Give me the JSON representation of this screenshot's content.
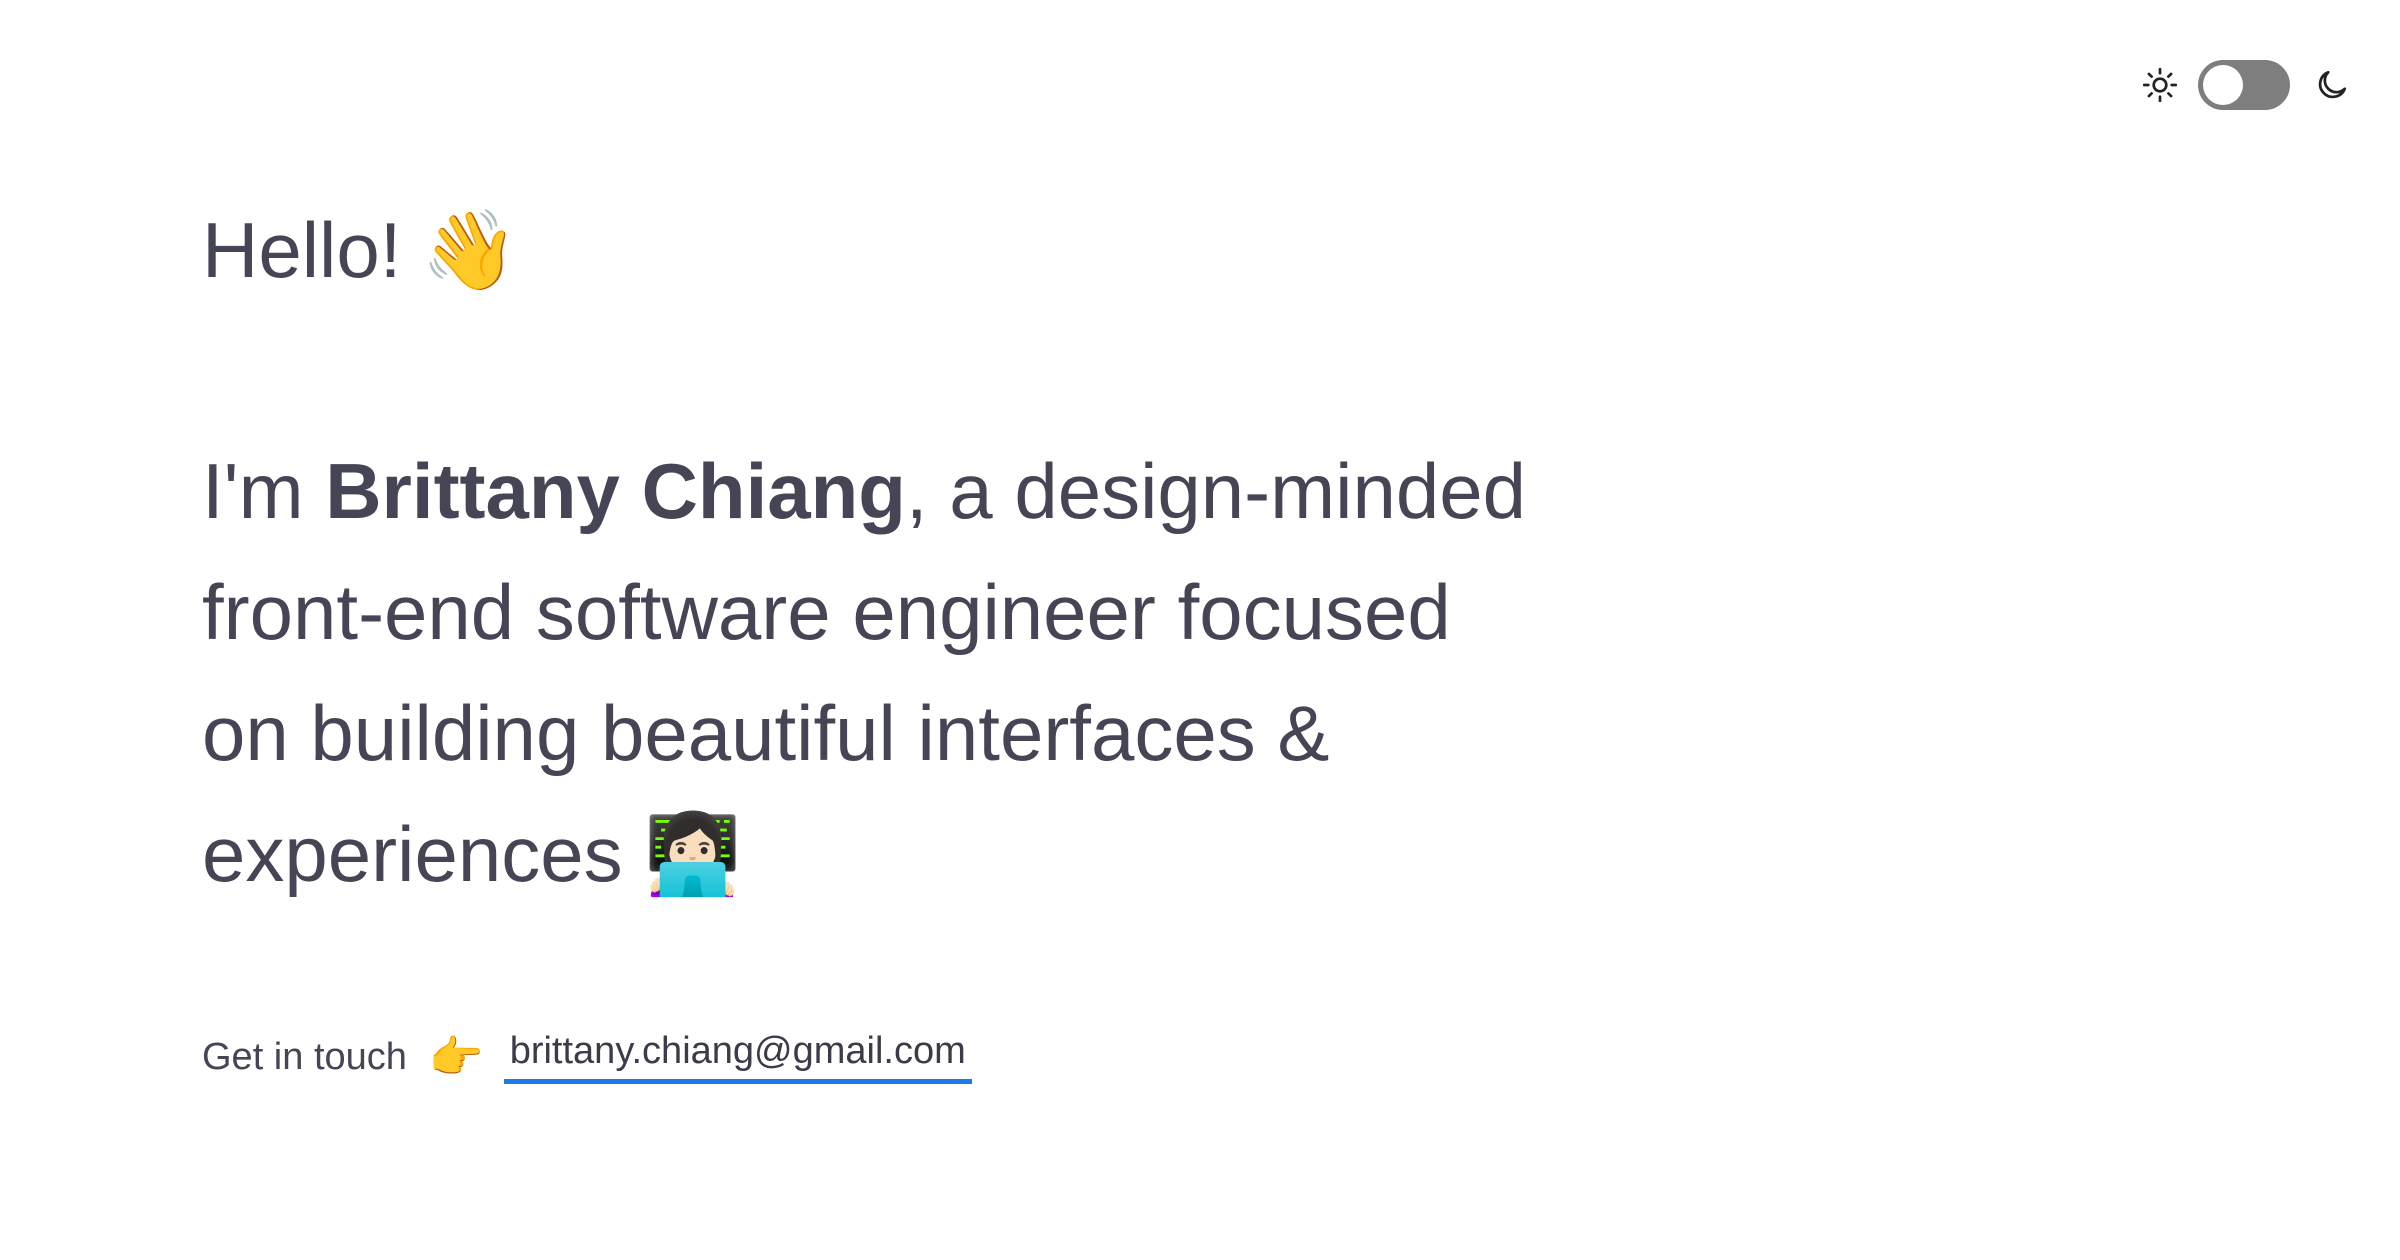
{
  "theme_toggle": {
    "sun_icon": "sun-icon",
    "moon_icon": "moon-icon",
    "dark_mode_enabled": false
  },
  "greeting": {
    "text": "Hello!",
    "emoji": "👋"
  },
  "intro": {
    "prefix": "I'm ",
    "name": "Brittany Chiang",
    "line1_rest": ", a design-minded",
    "line2": "front-end software engineer focused",
    "line3": "on building beautiful interfaces &",
    "line4": "experiences",
    "emoji": "👩🏻‍💻"
  },
  "contact": {
    "label": "Get in touch",
    "emoji": "👉",
    "email": "brittany.chiang@gmail.com"
  },
  "colors": {
    "text": "#454556",
    "link_underline": "#1e7ae6",
    "toggle_track": "#7e7e7e"
  }
}
